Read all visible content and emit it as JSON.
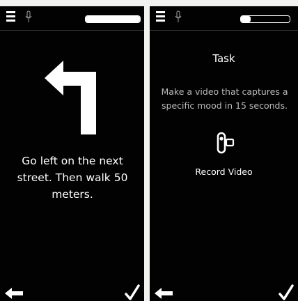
{
  "screens": [
    {
      "name": "navigation",
      "battery_level": 1.0,
      "instruction": "Go left on the next street. Then walk 50 meters."
    },
    {
      "name": "task",
      "battery_level": 0.2,
      "title": "Task",
      "description": "Make a video that captures a specific mood in 15 seconds.",
      "action_label": "Record Video"
    }
  ],
  "icons": {
    "menu": "menu-icon",
    "mic": "microphone-icon",
    "battery": "battery-icon",
    "turn_left": "turn-left-arrow-icon",
    "video": "video-camera-icon",
    "back": "back-arrow-icon",
    "confirm": "checkmark-icon"
  },
  "colors": {
    "screen_bg": "#020202",
    "page_bg": "#f2f2f0",
    "text": "#ffffff",
    "muted_text": "#bcbcbc"
  }
}
